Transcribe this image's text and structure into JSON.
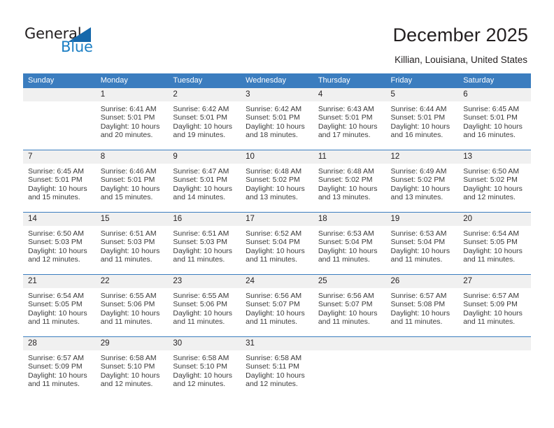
{
  "brand": {
    "name_part1": "General",
    "name_part2": "Blue",
    "accent_color": "#1c7fc4",
    "triangle_color": "#1668ab"
  },
  "header": {
    "title": "December 2025",
    "subtitle": "Killian, Louisiana, United States",
    "header_bg_color": "#3b7dbf",
    "daynum_bg_color": "#f0f0f0"
  },
  "weekday_headers": [
    "Sunday",
    "Monday",
    "Tuesday",
    "Wednesday",
    "Thursday",
    "Friday",
    "Saturday"
  ],
  "weeks": [
    [
      {
        "day": "",
        "blank": true
      },
      {
        "day": "1",
        "sunrise": "Sunrise: 6:41 AM",
        "sunset": "Sunset: 5:01 PM",
        "daylight_line1": "Daylight: 10 hours",
        "daylight_line2": "and 20 minutes."
      },
      {
        "day": "2",
        "sunrise": "Sunrise: 6:42 AM",
        "sunset": "Sunset: 5:01 PM",
        "daylight_line1": "Daylight: 10 hours",
        "daylight_line2": "and 19 minutes."
      },
      {
        "day": "3",
        "sunrise": "Sunrise: 6:42 AM",
        "sunset": "Sunset: 5:01 PM",
        "daylight_line1": "Daylight: 10 hours",
        "daylight_line2": "and 18 minutes."
      },
      {
        "day": "4",
        "sunrise": "Sunrise: 6:43 AM",
        "sunset": "Sunset: 5:01 PM",
        "daylight_line1": "Daylight: 10 hours",
        "daylight_line2": "and 17 minutes."
      },
      {
        "day": "5",
        "sunrise": "Sunrise: 6:44 AM",
        "sunset": "Sunset: 5:01 PM",
        "daylight_line1": "Daylight: 10 hours",
        "daylight_line2": "and 16 minutes."
      },
      {
        "day": "6",
        "sunrise": "Sunrise: 6:45 AM",
        "sunset": "Sunset: 5:01 PM",
        "daylight_line1": "Daylight: 10 hours",
        "daylight_line2": "and 16 minutes."
      }
    ],
    [
      {
        "day": "7",
        "sunrise": "Sunrise: 6:45 AM",
        "sunset": "Sunset: 5:01 PM",
        "daylight_line1": "Daylight: 10 hours",
        "daylight_line2": "and 15 minutes."
      },
      {
        "day": "8",
        "sunrise": "Sunrise: 6:46 AM",
        "sunset": "Sunset: 5:01 PM",
        "daylight_line1": "Daylight: 10 hours",
        "daylight_line2": "and 15 minutes."
      },
      {
        "day": "9",
        "sunrise": "Sunrise: 6:47 AM",
        "sunset": "Sunset: 5:01 PM",
        "daylight_line1": "Daylight: 10 hours",
        "daylight_line2": "and 14 minutes."
      },
      {
        "day": "10",
        "sunrise": "Sunrise: 6:48 AM",
        "sunset": "Sunset: 5:02 PM",
        "daylight_line1": "Daylight: 10 hours",
        "daylight_line2": "and 13 minutes."
      },
      {
        "day": "11",
        "sunrise": "Sunrise: 6:48 AM",
        "sunset": "Sunset: 5:02 PM",
        "daylight_line1": "Daylight: 10 hours",
        "daylight_line2": "and 13 minutes."
      },
      {
        "day": "12",
        "sunrise": "Sunrise: 6:49 AM",
        "sunset": "Sunset: 5:02 PM",
        "daylight_line1": "Daylight: 10 hours",
        "daylight_line2": "and 13 minutes."
      },
      {
        "day": "13",
        "sunrise": "Sunrise: 6:50 AM",
        "sunset": "Sunset: 5:02 PM",
        "daylight_line1": "Daylight: 10 hours",
        "daylight_line2": "and 12 minutes."
      }
    ],
    [
      {
        "day": "14",
        "sunrise": "Sunrise: 6:50 AM",
        "sunset": "Sunset: 5:03 PM",
        "daylight_line1": "Daylight: 10 hours",
        "daylight_line2": "and 12 minutes."
      },
      {
        "day": "15",
        "sunrise": "Sunrise: 6:51 AM",
        "sunset": "Sunset: 5:03 PM",
        "daylight_line1": "Daylight: 10 hours",
        "daylight_line2": "and 11 minutes."
      },
      {
        "day": "16",
        "sunrise": "Sunrise: 6:51 AM",
        "sunset": "Sunset: 5:03 PM",
        "daylight_line1": "Daylight: 10 hours",
        "daylight_line2": "and 11 minutes."
      },
      {
        "day": "17",
        "sunrise": "Sunrise: 6:52 AM",
        "sunset": "Sunset: 5:04 PM",
        "daylight_line1": "Daylight: 10 hours",
        "daylight_line2": "and 11 minutes."
      },
      {
        "day": "18",
        "sunrise": "Sunrise: 6:53 AM",
        "sunset": "Sunset: 5:04 PM",
        "daylight_line1": "Daylight: 10 hours",
        "daylight_line2": "and 11 minutes."
      },
      {
        "day": "19",
        "sunrise": "Sunrise: 6:53 AM",
        "sunset": "Sunset: 5:04 PM",
        "daylight_line1": "Daylight: 10 hours",
        "daylight_line2": "and 11 minutes."
      },
      {
        "day": "20",
        "sunrise": "Sunrise: 6:54 AM",
        "sunset": "Sunset: 5:05 PM",
        "daylight_line1": "Daylight: 10 hours",
        "daylight_line2": "and 11 minutes."
      }
    ],
    [
      {
        "day": "21",
        "sunrise": "Sunrise: 6:54 AM",
        "sunset": "Sunset: 5:05 PM",
        "daylight_line1": "Daylight: 10 hours",
        "daylight_line2": "and 11 minutes."
      },
      {
        "day": "22",
        "sunrise": "Sunrise: 6:55 AM",
        "sunset": "Sunset: 5:06 PM",
        "daylight_line1": "Daylight: 10 hours",
        "daylight_line2": "and 11 minutes."
      },
      {
        "day": "23",
        "sunrise": "Sunrise: 6:55 AM",
        "sunset": "Sunset: 5:06 PM",
        "daylight_line1": "Daylight: 10 hours",
        "daylight_line2": "and 11 minutes."
      },
      {
        "day": "24",
        "sunrise": "Sunrise: 6:56 AM",
        "sunset": "Sunset: 5:07 PM",
        "daylight_line1": "Daylight: 10 hours",
        "daylight_line2": "and 11 minutes."
      },
      {
        "day": "25",
        "sunrise": "Sunrise: 6:56 AM",
        "sunset": "Sunset: 5:07 PM",
        "daylight_line1": "Daylight: 10 hours",
        "daylight_line2": "and 11 minutes."
      },
      {
        "day": "26",
        "sunrise": "Sunrise: 6:57 AM",
        "sunset": "Sunset: 5:08 PM",
        "daylight_line1": "Daylight: 10 hours",
        "daylight_line2": "and 11 minutes."
      },
      {
        "day": "27",
        "sunrise": "Sunrise: 6:57 AM",
        "sunset": "Sunset: 5:09 PM",
        "daylight_line1": "Daylight: 10 hours",
        "daylight_line2": "and 11 minutes."
      }
    ],
    [
      {
        "day": "28",
        "sunrise": "Sunrise: 6:57 AM",
        "sunset": "Sunset: 5:09 PM",
        "daylight_line1": "Daylight: 10 hours",
        "daylight_line2": "and 11 minutes."
      },
      {
        "day": "29",
        "sunrise": "Sunrise: 6:58 AM",
        "sunset": "Sunset: 5:10 PM",
        "daylight_line1": "Daylight: 10 hours",
        "daylight_line2": "and 12 minutes."
      },
      {
        "day": "30",
        "sunrise": "Sunrise: 6:58 AM",
        "sunset": "Sunset: 5:10 PM",
        "daylight_line1": "Daylight: 10 hours",
        "daylight_line2": "and 12 minutes."
      },
      {
        "day": "31",
        "sunrise": "Sunrise: 6:58 AM",
        "sunset": "Sunset: 5:11 PM",
        "daylight_line1": "Daylight: 10 hours",
        "daylight_line2": "and 12 minutes."
      },
      {
        "day": "",
        "blank": true
      },
      {
        "day": "",
        "blank": true
      },
      {
        "day": "",
        "blank": true
      }
    ]
  ]
}
